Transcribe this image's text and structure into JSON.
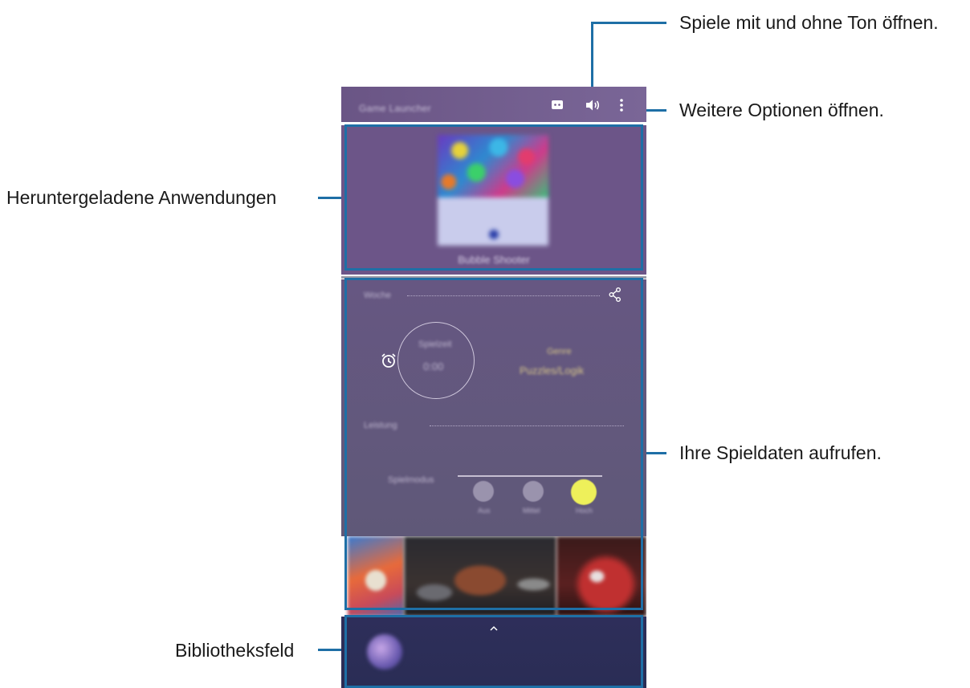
{
  "callouts": {
    "sound": "Spiele mit und ohne Ton öffnen.",
    "more_options": "Weitere Optionen öffnen.",
    "downloaded_apps": "Heruntergeladene Anwendungen",
    "game_data": "Ihre Spieldaten aufrufen.",
    "library_panel": "Bibliotheksfeld"
  },
  "phone": {
    "topbar": {
      "title": "Game Launcher",
      "icons": [
        "discord-icon",
        "speaker-icon",
        "more-vertical-icon"
      ]
    },
    "apps": {
      "game_name": "Bubble Shooter"
    },
    "stats": {
      "section1_label": "Woche",
      "ring_label": "Spielzeit",
      "ring_value": "0:00",
      "genre_label": "Genre",
      "genre_value": "Puzzles/Logik",
      "section2_label": "Leistung",
      "slider_label": "Spielmodus",
      "knob_labels": [
        "Aus",
        "Mittel",
        "Hoch"
      ]
    },
    "library": {
      "icons": [
        "game-avatar-icon",
        "chevron-up-icon"
      ]
    }
  },
  "colors": {
    "callout_line": "#1e6fa6",
    "highlight_border": "#1e6fa6",
    "active_knob": "#eef05a"
  }
}
